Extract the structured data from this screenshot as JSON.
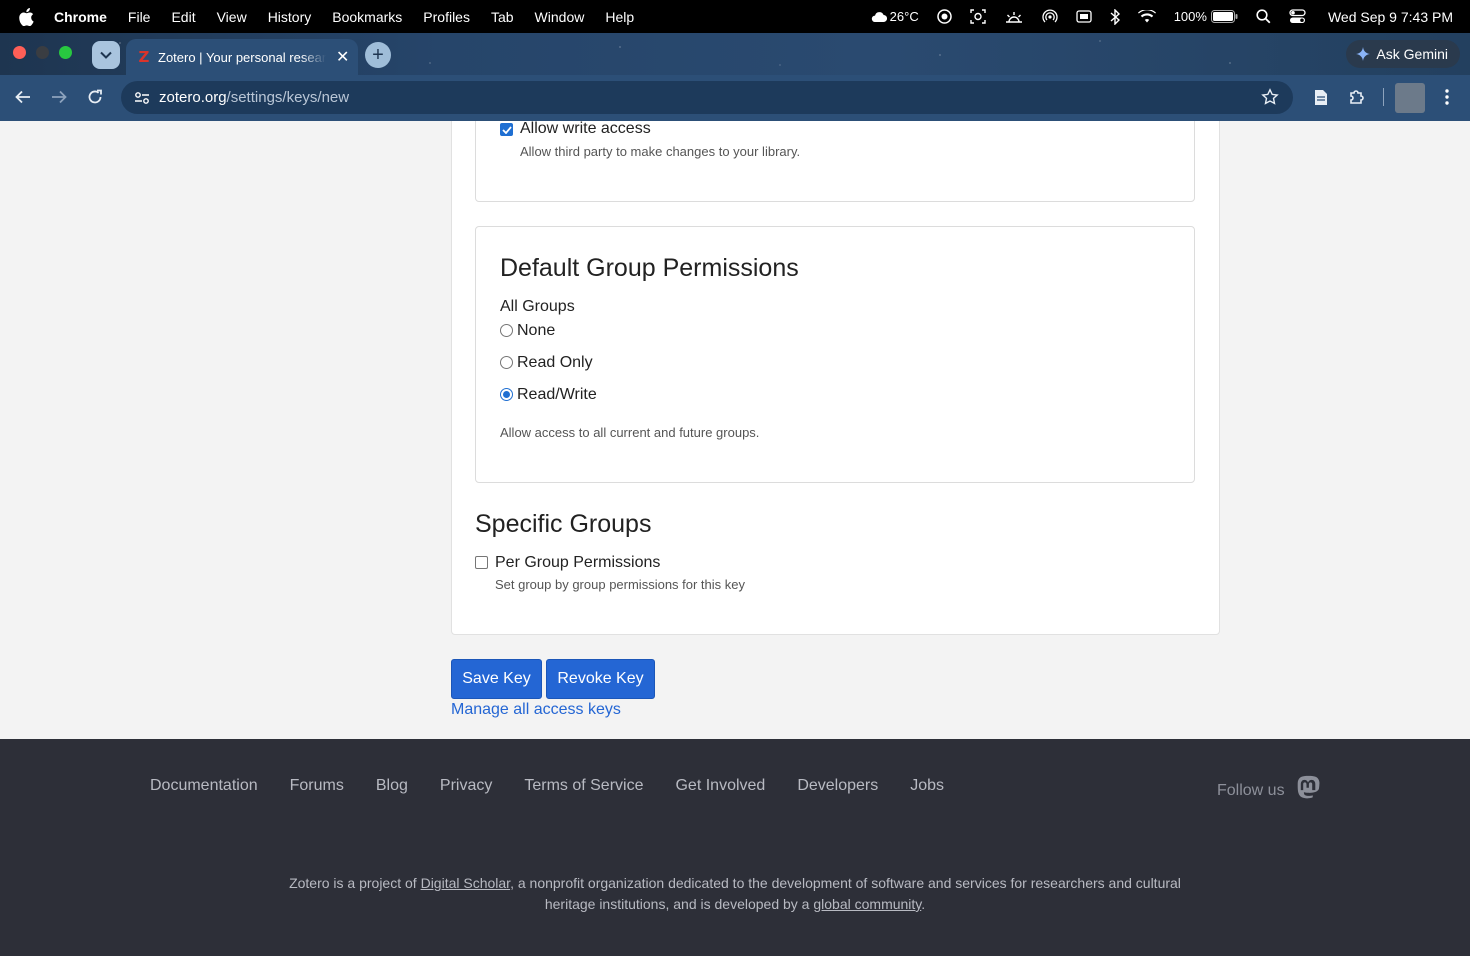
{
  "menubar": {
    "app": "Chrome",
    "items": [
      "File",
      "Edit",
      "View",
      "History",
      "Bookmarks",
      "Profiles",
      "Tab",
      "Window",
      "Help"
    ],
    "weather": "26°C",
    "battery": "100%",
    "datetime": "Wed Sep 9  7:43 PM"
  },
  "browser": {
    "tab_title": "Zotero | Your personal research",
    "url_domain": "zotero.org",
    "url_path": "/settings/keys/new",
    "gemini_label": "Ask Gemini"
  },
  "personal": {
    "write_label": "Allow write access",
    "write_checked": true,
    "write_help": "Allow third party to make changes to your library."
  },
  "group_permissions": {
    "heading": "Default Group Permissions",
    "group_label": "All Groups",
    "options": [
      "None",
      "Read Only",
      "Read/Write"
    ],
    "selected": "Read/Write",
    "help": "Allow access to all current and future groups."
  },
  "specific_groups": {
    "heading": "Specific Groups",
    "per_group_label": "Per Group Permissions",
    "per_group_checked": false,
    "per_group_help": "Set group by group permissions for this key"
  },
  "actions": {
    "save_label": "Save Key",
    "revoke_label": "Revoke Key",
    "manage_label": "Manage all access keys"
  },
  "footer": {
    "links": [
      "Documentation",
      "Forums",
      "Blog",
      "Privacy",
      "Terms of Service",
      "Get Involved",
      "Developers",
      "Jobs"
    ],
    "follow_label": "Follow us",
    "about_pre": "Zotero is a project of ",
    "about_link1": "Digital Scholar",
    "about_mid": ", a nonprofit organization dedicated to the development of software and services for researchers and cultural heritage institutions, and is developed by a ",
    "about_link2": "global community",
    "about_post": "."
  },
  "colors": {
    "accent": "#2466d4",
    "footer_bg": "#2d2f38",
    "toolbar": "#2c4f77"
  }
}
